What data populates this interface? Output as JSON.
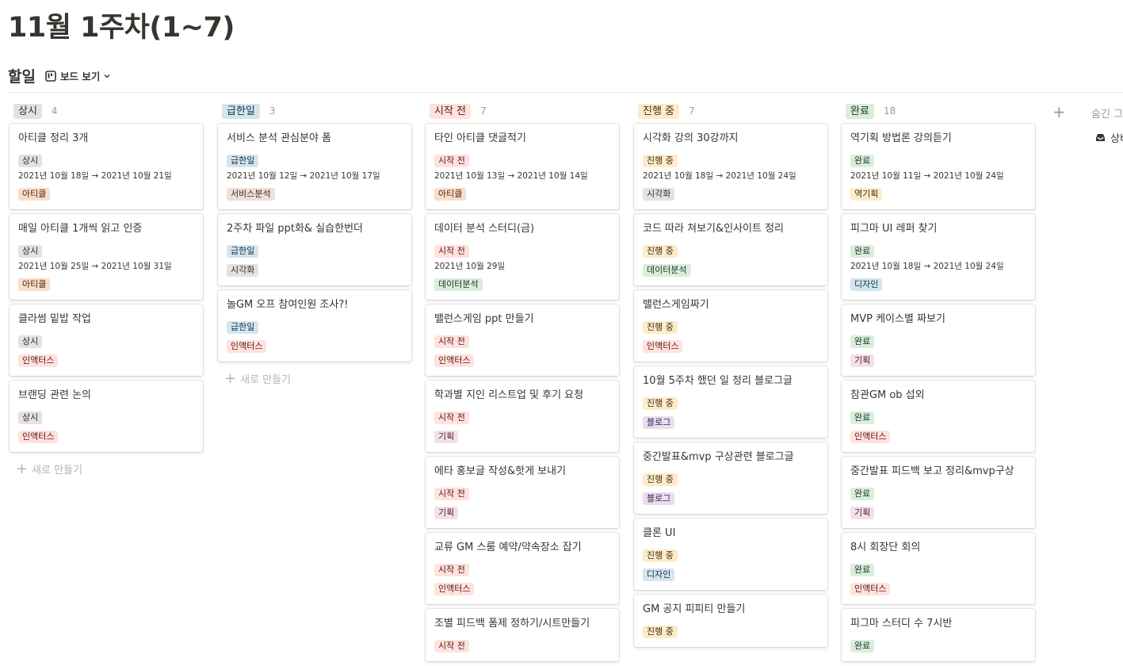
{
  "page": {
    "title": "11월 1주차(1~7)"
  },
  "database": {
    "title": "할일",
    "view_label": "보드 보기"
  },
  "colors": {
    "gray_bg": "#e3e2e0",
    "gray_fg": "#32302c",
    "blue_bg": "#d3e5ef",
    "blue_fg": "#183347",
    "red_bg": "#ffe2dd",
    "red_fg": "#5d1715",
    "yellow_bg": "#fdecc8",
    "yellow_fg": "#402c1b",
    "green_bg": "#dbeddb",
    "green_fg": "#1c3829",
    "orange_bg": "#fadec9",
    "orange_fg": "#49290e",
    "brown_bg": "#eee0da",
    "brown_fg": "#442a1e",
    "purple_bg": "#e8deee",
    "purple_fg": "#412454",
    "pink_bg": "#f5e0e9",
    "pink_fg": "#4c2337"
  },
  "board": {
    "new_label": "새로 만들기",
    "hidden_groups_label": "숨긴 그",
    "hidden_item_label": "상비",
    "columns": [
      {
        "name": "상시",
        "count": "4",
        "color": "gray",
        "cards": [
          {
            "title": "아티클 정리 3개",
            "status": "상시",
            "date": "2021년 10월 18일 → 2021년 10월 21일",
            "tag": "아티클",
            "tag_color": "orange"
          },
          {
            "title": "매일 아티클 1개씩 읽고 인증",
            "status": "상시",
            "date": "2021년 10월 25일 → 2021년 10월 31일",
            "tag": "아티클",
            "tag_color": "orange"
          },
          {
            "title": "클라썸 밑밥 작업",
            "status": "상시",
            "date": "",
            "tag": "인액터스",
            "tag_color": "red"
          },
          {
            "title": "브랜딩 관련 논의",
            "status": "상시",
            "date": "",
            "tag": "인액터스",
            "tag_color": "red"
          }
        ],
        "show_new": true
      },
      {
        "name": "급한일",
        "count": "3",
        "color": "blue",
        "cards": [
          {
            "title": "서비스 분석 관심분야 폼",
            "status": "급한일",
            "date": "2021년 10월 12일 → 2021년 10월 17일",
            "tag": "서비스분석",
            "tag_color": "brown"
          },
          {
            "title": "2주차 파일 ppt화& 실습한번더",
            "status": "급한일",
            "date": "",
            "tag": "시각화",
            "tag_color": "gray"
          },
          {
            "title": "놀GM 오프 참여인원 조사?!",
            "status": "급한일",
            "date": "",
            "tag": "인액터스",
            "tag_color": "red"
          }
        ],
        "show_new": true
      },
      {
        "name": "시작 전",
        "count": "7",
        "color": "red",
        "cards": [
          {
            "title": "타인 아티클 댓글적기",
            "status": "시작 전",
            "date": "2021년 10월 13일 → 2021년 10월 14일",
            "tag": "아티클",
            "tag_color": "orange"
          },
          {
            "title": "데이터 분석 스터디(금)",
            "status": "시작 전",
            "date": "2021년 10월 29일",
            "tag": "데이터분석",
            "tag_color": "green"
          },
          {
            "title": "밸런스게임 ppt 만들기",
            "status": "시작 전",
            "date": "",
            "tag": "인액터스",
            "tag_color": "red"
          },
          {
            "title": "학과별 지인 리스트업 및 후기 요청",
            "status": "시작 전",
            "date": "",
            "tag": "기획",
            "tag_color": "pink"
          },
          {
            "title": "에타 홍보글 작성&핫게 보내기",
            "status": "시작 전",
            "date": "",
            "tag": "기획",
            "tag_color": "pink"
          },
          {
            "title": "교류 GM 스룸 예약/약속장소 잡기",
            "status": "시작 전",
            "date": "",
            "tag": "인액터스",
            "tag_color": "red"
          },
          {
            "title": "조별 피드백 폼제 정하기/시트만들기",
            "status": "시작 전",
            "date": "",
            "tag": "",
            "tag_color": "red"
          }
        ],
        "show_new": false
      },
      {
        "name": "진행 중",
        "count": "7",
        "color": "yellow",
        "cards": [
          {
            "title": "시각화 강의 30강까지",
            "status": "진행 중",
            "date": "2021년 10월 18일 → 2021년 10월 24일",
            "tag": "시각화",
            "tag_color": "gray"
          },
          {
            "title": "코드 따라 쳐보기&인사이트 정리",
            "status": "진행 중",
            "date": "",
            "tag": "데이터분석",
            "tag_color": "green"
          },
          {
            "title": "밸런스게임짜기",
            "status": "진행 중",
            "date": "",
            "tag": "인액터스",
            "tag_color": "red"
          },
          {
            "title": "10월 5주차 했던 일 정리 블로그글",
            "status": "진행 중",
            "date": "",
            "tag": "블로그",
            "tag_color": "purple"
          },
          {
            "title": "중간발표&mvp 구상관련 블로그글",
            "status": "진행 중",
            "date": "",
            "tag": "블로그",
            "tag_color": "purple"
          },
          {
            "title": "클론 UI",
            "status": "진행 중",
            "date": "",
            "tag": "디자인",
            "tag_color": "blue"
          },
          {
            "title": "GM 공지 피피티 만들기",
            "status": "진행 중",
            "date": "",
            "tag": "",
            "tag_color": "gray"
          }
        ],
        "show_new": false
      },
      {
        "name": "완료",
        "count": "18",
        "color": "green",
        "cards": [
          {
            "title": "역기획 방법론 강의듣기",
            "status": "완료",
            "date": "2021년 10월 11일 → 2021년 10월 24일",
            "tag": "역기획",
            "tag_color": "yellow"
          },
          {
            "title": "피그마 UI 레퍼 찾기",
            "status": "완료",
            "date": "2021년 10월 18일 → 2021년 10월 24일",
            "tag": "디자인",
            "tag_color": "blue"
          },
          {
            "title": "MVP 케이스별 짜보기",
            "status": "완료",
            "date": "",
            "tag": "기획",
            "tag_color": "pink"
          },
          {
            "title": "참관GM ob 섭외",
            "status": "완료",
            "date": "",
            "tag": "인액터스",
            "tag_color": "red"
          },
          {
            "title": "중간발표 피드백 보고 정리&mvp구상",
            "status": "완료",
            "date": "",
            "tag": "기획",
            "tag_color": "pink"
          },
          {
            "title": "8시 회장단 회의",
            "status": "완료",
            "date": "",
            "tag": "인액터스",
            "tag_color": "red"
          },
          {
            "title": "피그마 스터디 수 7시반",
            "status": "완료",
            "date": "",
            "tag": "",
            "tag_color": "gray"
          }
        ],
        "show_new": false
      }
    ]
  }
}
